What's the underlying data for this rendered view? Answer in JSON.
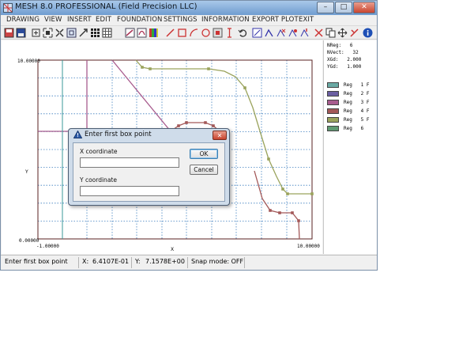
{
  "window": {
    "title": "MESH 8.0 PROFESSIONAL (Field Precision LLC)",
    "minimize_label": "–",
    "maximize_label": "□",
    "close_label": "✕"
  },
  "menu": [
    "DRAWING",
    "VIEW",
    "INSERT",
    "EDIT",
    "FOUNDATION",
    "SETTINGS",
    "INFORMATION",
    "EXPORT PLOT",
    "EXIT"
  ],
  "toolbar_icons": [
    "save-icon",
    "open-icon",
    "zoom-window-icon",
    "zoom-fit-icon",
    "zoom-in-icon",
    "zoom-out-icon",
    "pan-icon",
    "grid-icon",
    "grid-toggle-icon",
    "draw-region-icon",
    "draw-fill-icon",
    "palette-icon",
    "line-icon",
    "rectangle-icon",
    "arc-icon",
    "circle-icon",
    "point-icon",
    "vertical-line-icon",
    "undo-icon",
    "select-vector-icon",
    "move-vector-icon",
    "delete-vector-icon",
    "edit-vector-icon",
    "cut-icon",
    "copy-icon",
    "move-icon",
    "delete-icon",
    "info-icon"
  ],
  "plot": {
    "xmin_label": "-1.00000",
    "xmax_label": "10.00000",
    "ymin_label": "0.00000",
    "ymax_label": "10.00000",
    "xlabel": "X",
    "ylabel": "Y"
  },
  "info": {
    "nreg_label": "NReg:",
    "nreg_value": "6",
    "nvect_label": "NVect:",
    "nvect_value": "32",
    "xgd_label": "XGd:",
    "xgd_value": "2.000",
    "ygd_label": "YGd:",
    "ygd_value": "1.000"
  },
  "colors": {
    "reg1": "#6aa9a4",
    "reg2": "#6b5fa2",
    "reg3": "#a85c8e",
    "reg4": "#a35858",
    "reg5": "#9aa35c",
    "reg6": "#5f9a72",
    "grid_solid": "#3a9a9a",
    "grid_dotted": "#3f7fbf"
  },
  "legend": [
    {
      "label": "Reg   1 F",
      "color": "#6aa9a4"
    },
    {
      "label": "Reg   2 F",
      "color": "#6b5fa2"
    },
    {
      "label": "Reg   3 F",
      "color": "#a85c8e"
    },
    {
      "label": "Reg   4 F",
      "color": "#a35858"
    },
    {
      "label": "Reg   5 F",
      "color": "#9aa35c"
    },
    {
      "label": "Reg   6",
      "color": "#5f9a72"
    }
  ],
  "status": {
    "message": "Enter first box point",
    "x_label": "X:",
    "x_value": "6.4107E-01",
    "y_label": "Y:",
    "y_value": "7.1578E+00",
    "snap": "Snap mode: OFF"
  },
  "dialog": {
    "title": "Enter first box point",
    "x_label": "X coordinate",
    "x_value": "",
    "y_label": "Y coordinate",
    "y_value": "",
    "ok_label": "OK",
    "cancel_label": "Cancel",
    "close_label": "✕"
  }
}
